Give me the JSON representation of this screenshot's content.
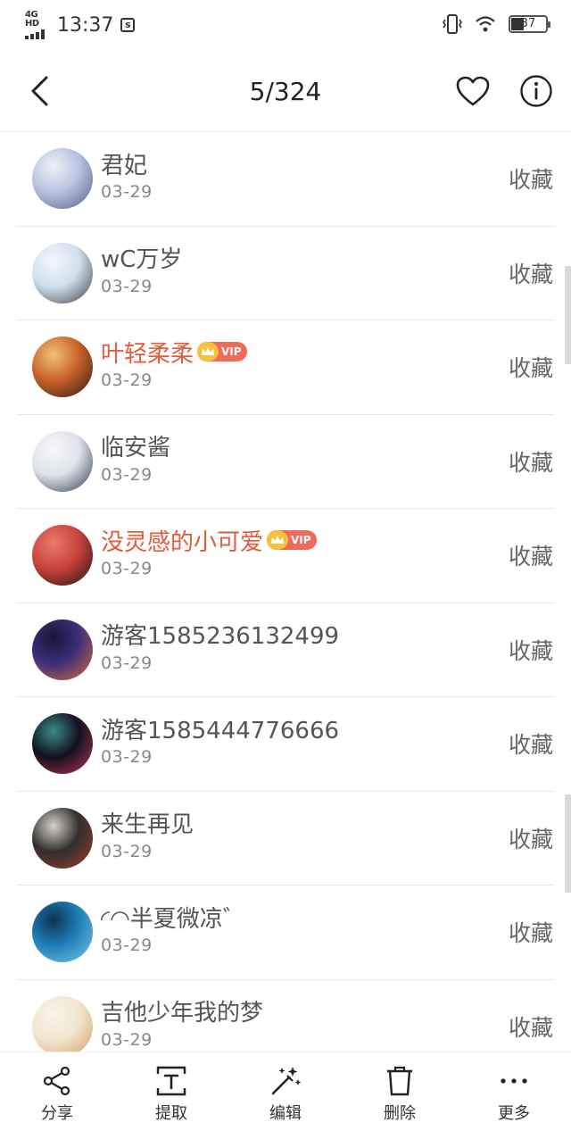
{
  "status_bar": {
    "network": "4G HD",
    "time": "13:37",
    "battery": "37"
  },
  "header": {
    "counter": "5/324"
  },
  "list": {
    "items": [
      {
        "name": "君妃",
        "date": "03-29",
        "action": "收藏",
        "vip": false,
        "avatar_colors": [
          "#b9c3de",
          "#545e86",
          "#eef0f7"
        ]
      },
      {
        "name": "wC万岁",
        "date": "03-29",
        "action": "收藏",
        "vip": false,
        "avatar_colors": [
          "#cfe0ee",
          "#3c3c3c",
          "#f4f7fa"
        ]
      },
      {
        "name": "叶轻柔柔",
        "date": "03-29",
        "action": "收藏",
        "vip": true,
        "vip_label": "VIP",
        "avatar_colors": [
          "#c8612a",
          "#2a1a12",
          "#f0c27a"
        ]
      },
      {
        "name": "临安酱",
        "date": "03-29",
        "action": "收藏",
        "vip": false,
        "avatar_colors": [
          "#dfe3ea",
          "#2e3550",
          "#f7f7f9"
        ]
      },
      {
        "name": "没灵感的小可爱",
        "date": "03-29",
        "action": "收藏",
        "vip": true,
        "vip_label": "VIP",
        "avatar_colors": [
          "#c9443b",
          "#1e0f10",
          "#e87a6a"
        ]
      },
      {
        "name": "游客1585236132499",
        "date": "03-29",
        "action": "收藏",
        "vip": false,
        "avatar_colors": [
          "#3e2f7a",
          "#d96b3a",
          "#1a1438"
        ]
      },
      {
        "name": "游客1585444776666",
        "date": "03-29",
        "action": "收藏",
        "vip": false,
        "avatar_colors": [
          "#14101e",
          "#b8365a",
          "#3a8a8a"
        ]
      },
      {
        "name": "来生再见",
        "date": "03-29",
        "action": "收藏",
        "vip": false,
        "avatar_colors": [
          "#2f2f2f",
          "#a83a2a",
          "#d9d0c6"
        ]
      },
      {
        "name": "◜◠半夏微凉゛",
        "date": "03-29",
        "action": "收藏",
        "vip": false,
        "avatar_colors": [
          "#1e7fb8",
          "#7ec8e6",
          "#0d3350"
        ]
      },
      {
        "name": "吉他少年我的梦",
        "date": "03-29",
        "action": "收藏",
        "vip": false,
        "avatar_colors": [
          "#f1e6cf",
          "#d1a066",
          "#f8f3ea"
        ]
      }
    ]
  },
  "toolbar": {
    "items": [
      {
        "label": "分享",
        "icon": "share-icon"
      },
      {
        "label": "提取",
        "icon": "extract-text-icon"
      },
      {
        "label": "编辑",
        "icon": "magic-wand-icon"
      },
      {
        "label": "删除",
        "icon": "trash-icon"
      },
      {
        "label": "更多",
        "icon": "more-icon"
      }
    ]
  },
  "colors": {
    "vip_name": "#e45a3a",
    "vip_badge": "#f06a5a",
    "crown": "#f5c33b"
  }
}
